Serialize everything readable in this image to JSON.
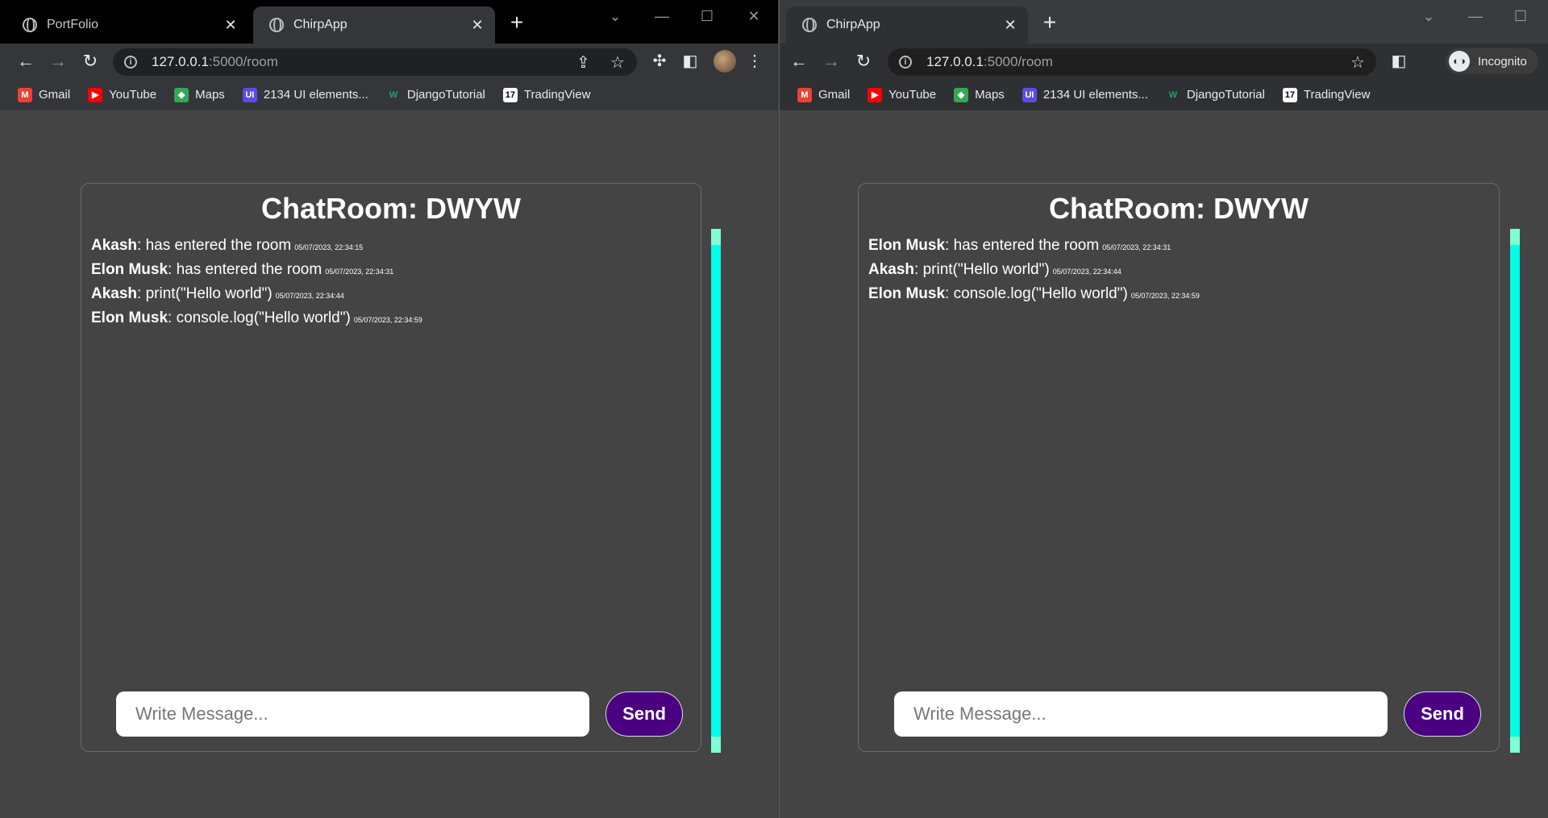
{
  "left": {
    "tabs": [
      {
        "title": "PortFolio",
        "active": false
      },
      {
        "title": "ChirpApp",
        "active": true
      }
    ],
    "address": {
      "host": "127.0.0.1",
      "path": ":5000/room"
    },
    "bookmarks": [
      "Gmail",
      "YouTube",
      "Maps",
      "2134 UI elements...",
      "DjangoTutorial",
      "TradingView"
    ],
    "chat": {
      "title": "ChatRoom: DWYW",
      "messages": [
        {
          "user": "Akash",
          "text": ": has entered the room",
          "time": "05/07/2023, 22:34:15"
        },
        {
          "user": "Elon Musk",
          "text": ": has entered the room",
          "time": "05/07/2023, 22:34:31"
        },
        {
          "user": "Akash",
          "text": ": print(\"Hello world\")",
          "time": "05/07/2023, 22:34:44"
        },
        {
          "user": "Elon Musk",
          "text": ": console.log(\"Hello world\")",
          "time": "05/07/2023, 22:34:59"
        }
      ],
      "input_placeholder": "Write Message...",
      "send_label": "Send"
    }
  },
  "right": {
    "tabs": [
      {
        "title": "ChirpApp",
        "active": true
      }
    ],
    "address": {
      "host": "127.0.0.1",
      "path": ":5000/room"
    },
    "incognito_label": "Incognito",
    "bookmarks": [
      "Gmail",
      "YouTube",
      "Maps",
      "2134 UI elements...",
      "DjangoTutorial",
      "TradingView"
    ],
    "chat": {
      "title": "ChatRoom: DWYW",
      "messages": [
        {
          "user": "Elon Musk",
          "text": ": has entered the room",
          "time": "05/07/2023, 22:34:31"
        },
        {
          "user": "Akash",
          "text": ": print(\"Hello world\")",
          "time": "05/07/2023, 22:34:44"
        },
        {
          "user": "Elon Musk",
          "text": ": console.log(\"Hello world\")",
          "time": "05/07/2023, 22:34:59"
        }
      ],
      "input_placeholder": "Write Message...",
      "send_label": "Send"
    }
  },
  "colors": {
    "page_bg": "#444444",
    "send_button": "#4b0082",
    "scrollbar": "#00ffe8"
  },
  "icons": {
    "bookmark_icons": [
      "gmail-icon",
      "youtube-icon",
      "maps-icon",
      "ui-elements-icon",
      "django-icon",
      "tradingview-icon"
    ]
  }
}
